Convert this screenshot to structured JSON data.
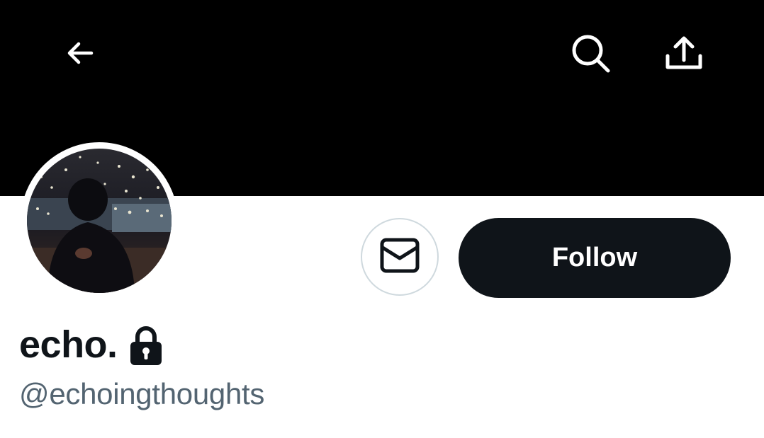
{
  "header": {
    "back_icon": "arrow-left-icon",
    "search_icon": "search-icon",
    "share_icon": "share-upload-icon",
    "banner_color": "#000000"
  },
  "profile": {
    "display_name": "echo.",
    "handle": "@echoingthoughts",
    "protected_icon": "lock-icon",
    "avatar": "avatar-photo"
  },
  "actions": {
    "message_icon": "envelope-icon",
    "follow_label": "Follow"
  },
  "colors": {
    "primary_text": "#0f1419",
    "secondary_text": "#536471",
    "follow_button_bg": "#0f1419",
    "border": "#cfd9de"
  }
}
